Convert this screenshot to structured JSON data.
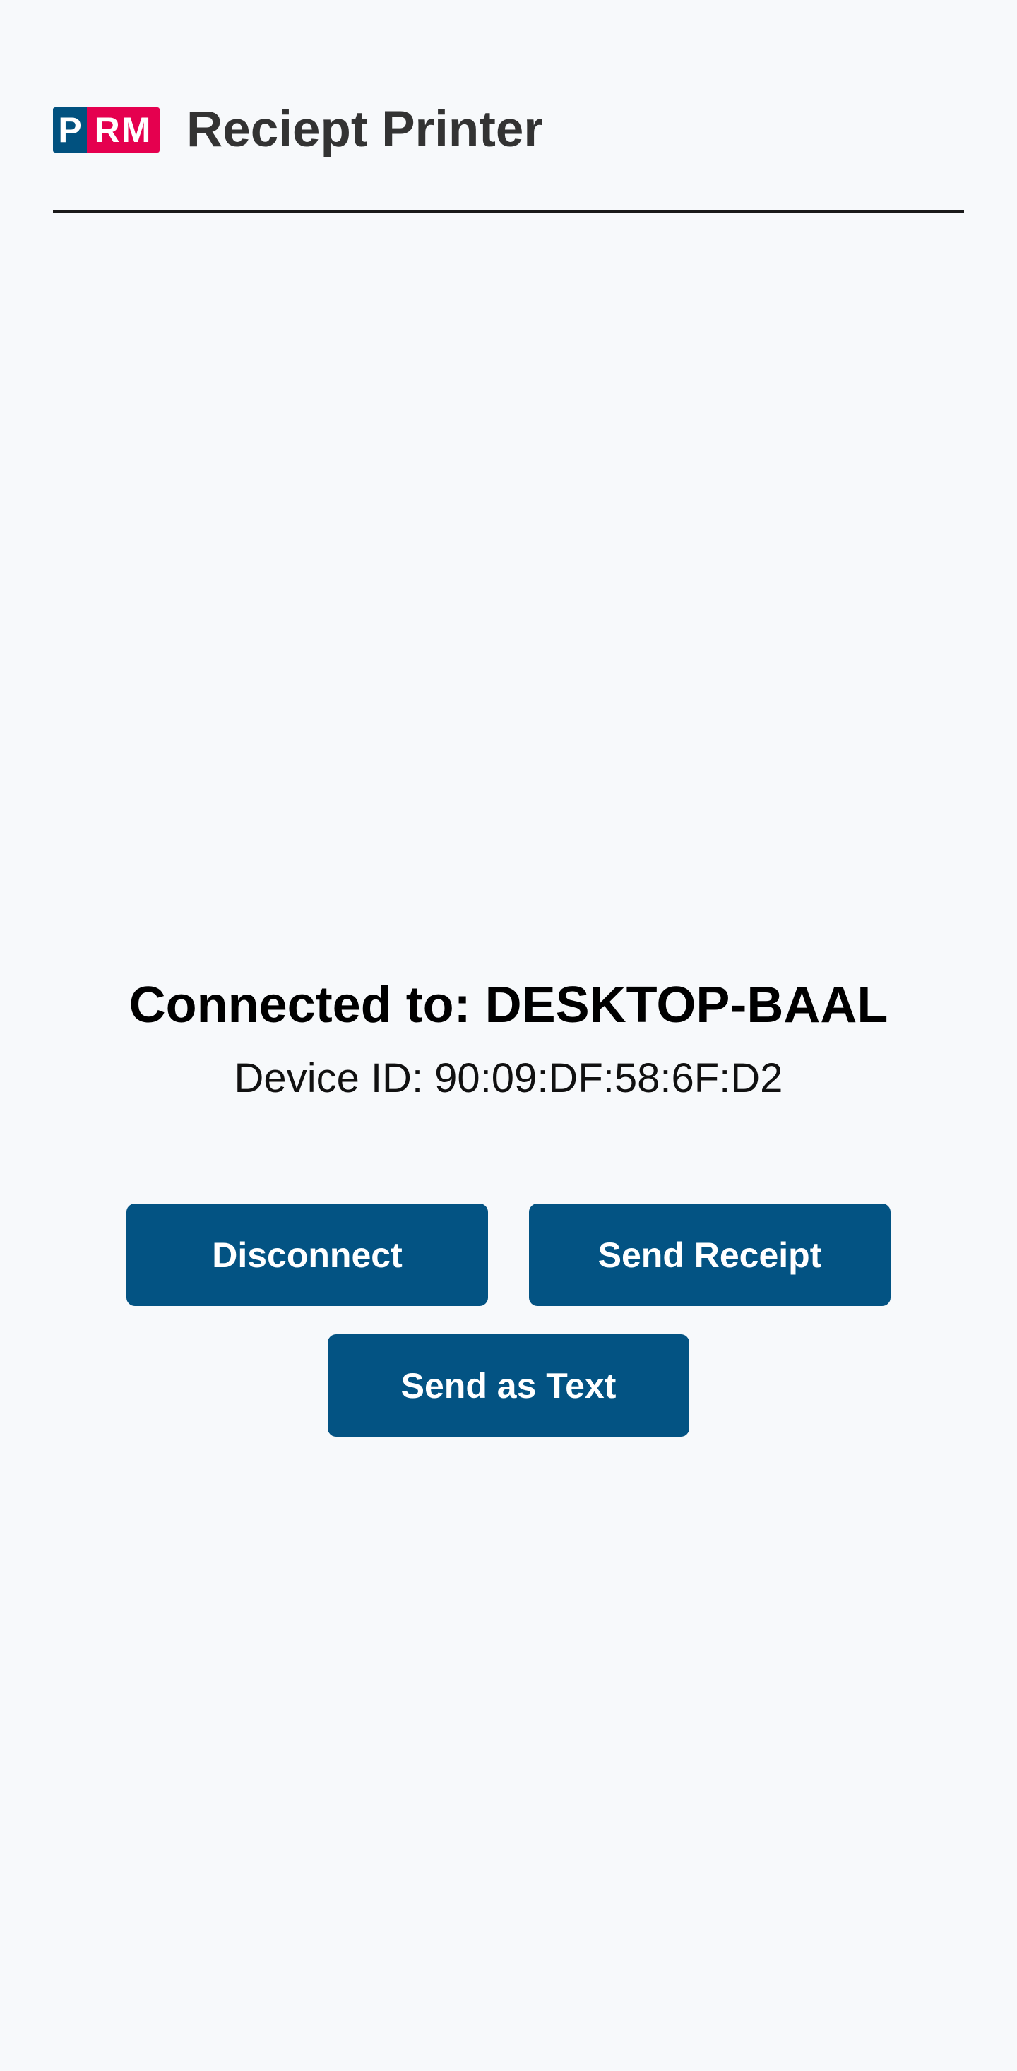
{
  "header": {
    "logo": {
      "left_text": "P",
      "right_text": "RM",
      "left_color": "#01517f",
      "right_color": "#e5004f"
    },
    "title": "Reciept Printer"
  },
  "status": {
    "connected_text": "Connected to: DESKTOP-BAAL",
    "device_id_text": "Device ID: 90:09:DF:58:6F:D2"
  },
  "actions": {
    "disconnect_label": "Disconnect",
    "send_receipt_label": "Send Receipt",
    "send_text_label": "Send as Text",
    "button_color": "#035383"
  }
}
